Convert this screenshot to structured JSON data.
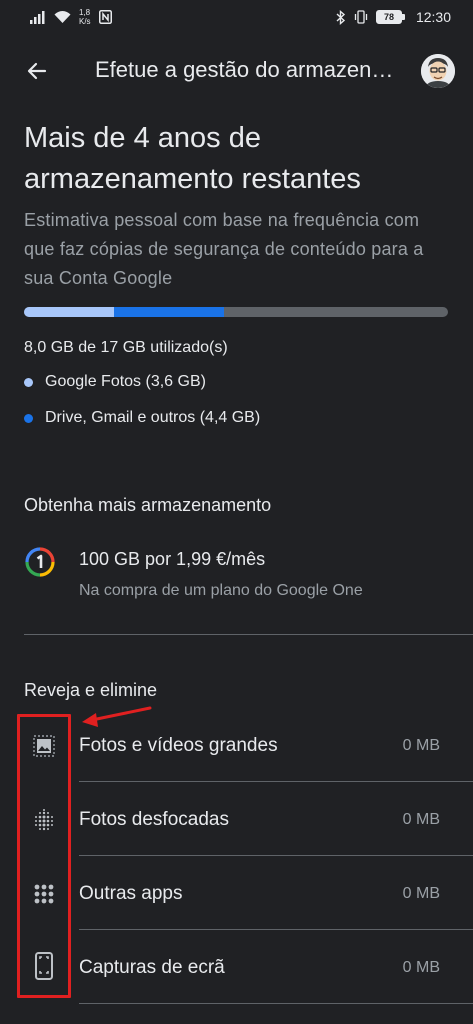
{
  "status_bar": {
    "speed_value": "1,8",
    "speed_unit": "K/s",
    "battery": "78",
    "time": "12:30"
  },
  "app_bar": {
    "title": "Efetue a gestão do armazenamento",
    "back_icon": "arrow-back-icon",
    "avatar_icon": "avatar"
  },
  "storage": {
    "headline": "Mais de 4 anos de armazenamento restantes",
    "description": "Estimativa pessoal com base na frequência com que faz cópias de segurança de conteúdo para a sua Conta Google",
    "used_text": "8,0 GB de 17 GB utilizado(s)",
    "used_fraction": 0.47,
    "breakdown": [
      {
        "label": "Google Fotos (3,6 GB)",
        "color": "#a8c7fa",
        "fraction": 0.212
      },
      {
        "label": "Drive, Gmail e outros (4,4 GB)",
        "color": "#1a73e8",
        "fraction": 0.259
      }
    ]
  },
  "get_more": {
    "title": "Obtenha mais armazenamento",
    "offer_title": "100 GB por 1,99 €/mês",
    "offer_sub": "Na compra de um plano do Google One",
    "icon": "google-one-icon"
  },
  "review": {
    "title": "Reveja e elimine",
    "items": [
      {
        "label": "Fotos e vídeos grandes",
        "size": "0 MB",
        "icon": "large-photo-icon"
      },
      {
        "label": "Fotos desfocadas",
        "size": "0 MB",
        "icon": "blurry-photo-icon"
      },
      {
        "label": "Outras apps",
        "size": "0 MB",
        "icon": "apps-grid-icon"
      },
      {
        "label": "Capturas de ecrã",
        "size": "0 MB",
        "icon": "screenshot-icon"
      }
    ]
  },
  "colors": {
    "background": "#202124",
    "highlight": "#e02020"
  }
}
